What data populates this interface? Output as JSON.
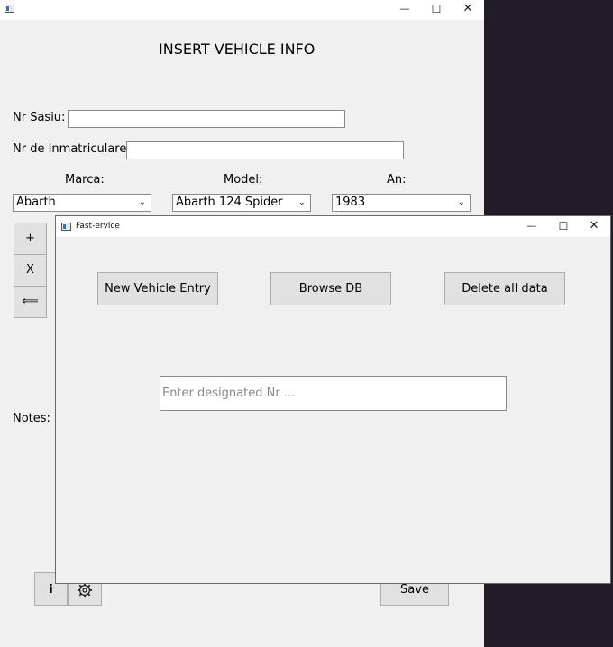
{
  "back_window": {
    "title_controls": {
      "minimize": "—",
      "maximize": "☐",
      "close": "✕"
    },
    "heading": "INSERT VEHICLE INFO",
    "nr_sasiu_label": "Nr Sasiu:",
    "nr_inmatriculare_label": "Nr de Inmatriculare:",
    "marca_label": "Marca:",
    "model_label": "Model:",
    "an_label": "An:",
    "marca_value": "Abarth",
    "model_value": "Abarth 124 Spider",
    "an_value": "1983",
    "side_buttons": {
      "add": "+",
      "remove": "X",
      "back": "⟸"
    },
    "notes_label": "Notes:",
    "info_button": "i",
    "save_button": "Save"
  },
  "front_window": {
    "title": "Fast-ervice",
    "title_controls": {
      "minimize": "—",
      "maximize": "☐",
      "close": "✕"
    },
    "new_vehicle_button": "New Vehicle Entry",
    "browse_db_button": "Browse DB",
    "delete_all_button": "Delete all data",
    "designated_input": {
      "value": "",
      "placeholder": "Enter designated Nr ..."
    }
  }
}
